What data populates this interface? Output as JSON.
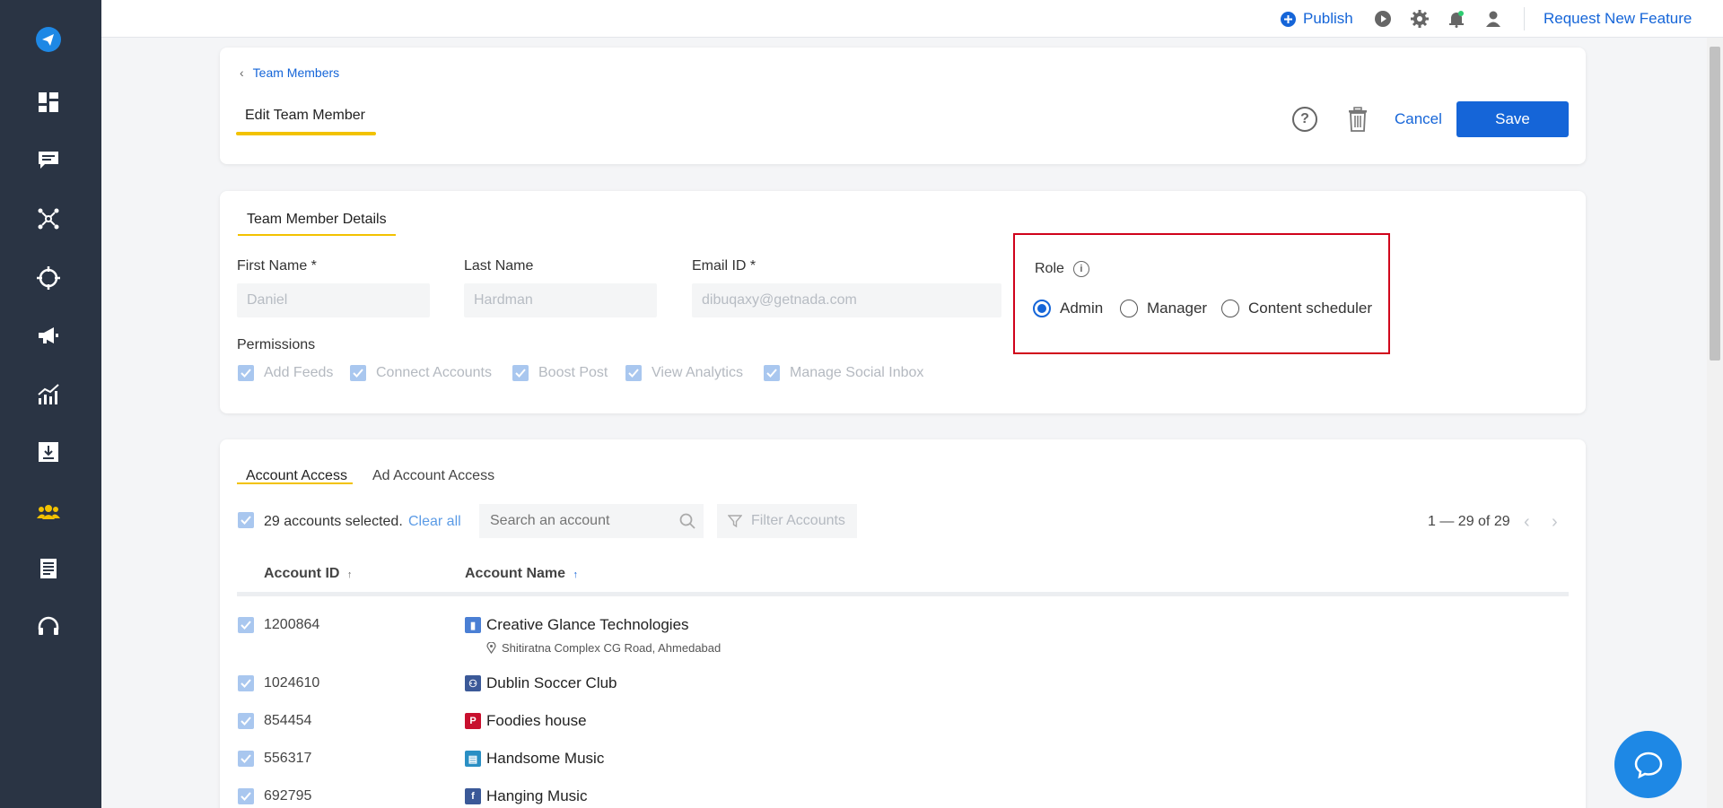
{
  "topbar": {
    "publish_label": "Publish",
    "request_feature_label": "Request New Feature"
  },
  "sidebar": {
    "items": [
      "send-logo",
      "dashboard",
      "feedback",
      "integrations",
      "listening",
      "campaigns",
      "analytics",
      "downloads",
      "team",
      "reports",
      "support"
    ]
  },
  "header": {
    "breadcrumb": "Team Members",
    "title": "Edit Team Member",
    "cancel_label": "Cancel",
    "save_label": "Save"
  },
  "details": {
    "section_title": "Team Member Details",
    "first_name_label": "First Name *",
    "first_name_value": "Daniel",
    "last_name_label": "Last Name",
    "last_name_value": "Hardman",
    "email_label": "Email ID *",
    "email_value": "dibuqaxy@getnada.com",
    "permissions_label": "Permissions",
    "permissions": [
      "Add Feeds",
      "Connect Accounts",
      "Boost Post",
      "View Analytics",
      "Manage Social Inbox"
    ],
    "role_label": "Role",
    "roles": [
      "Admin",
      "Manager",
      "Content scheduler"
    ],
    "selected_role": "Admin"
  },
  "accounts": {
    "tabs": [
      "Account Access",
      "Ad Account Access"
    ],
    "active_tab": "Account Access",
    "selected_text": "29 accounts selected.",
    "clear_all_label": "Clear all",
    "search_placeholder": "Search an account",
    "filter_label": "Filter Accounts",
    "pagination": "1 — 29 of 29",
    "columns": [
      "Account ID",
      "Account Name"
    ],
    "rows": [
      {
        "id": "1200864",
        "name": "Creative Glance Technologies",
        "address": "Shitiratna Complex CG Road, Ahmedabad",
        "platform": "google-business"
      },
      {
        "id": "1024610",
        "name": "Dublin Soccer Club",
        "platform": "facebook-group"
      },
      {
        "id": "854454",
        "name": "Foodies house",
        "platform": "pinterest"
      },
      {
        "id": "556317",
        "name": "Handsome Music",
        "platform": "youtube-channel"
      },
      {
        "id": "692795",
        "name": "Hanging Music",
        "platform": "facebook"
      }
    ]
  },
  "colors": {
    "sidebar": "#2a3444",
    "accent": "#1565d8",
    "highlight_yellow": "#f2c200",
    "role_box_border": "#d0021b"
  }
}
